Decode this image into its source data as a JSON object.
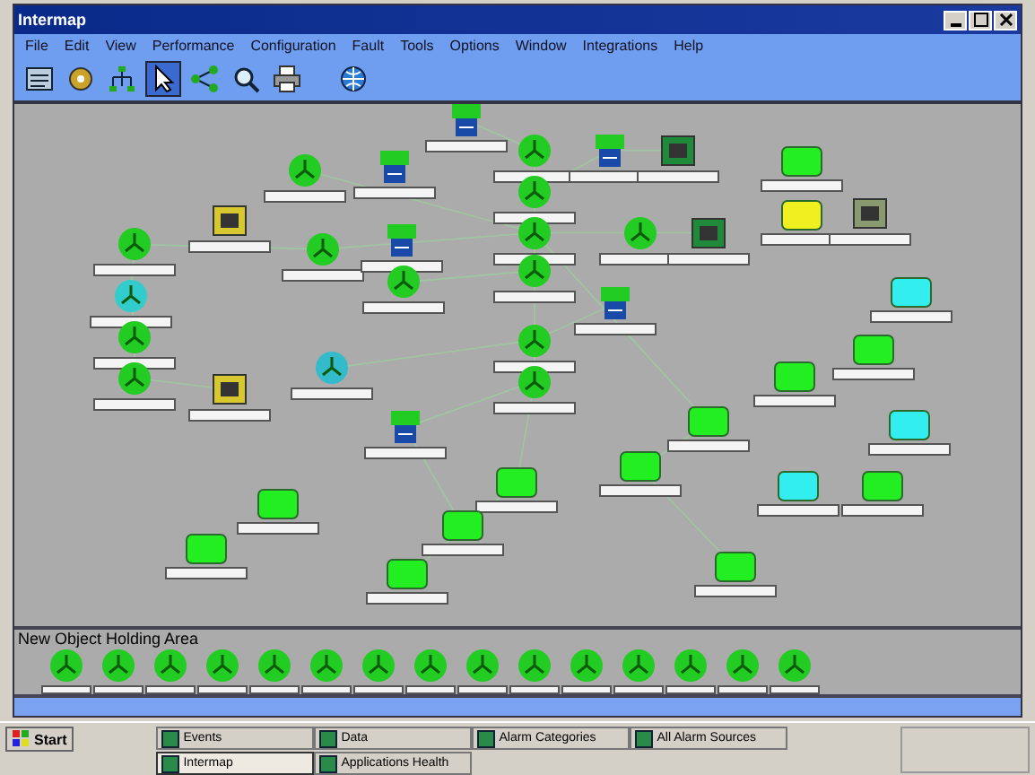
{
  "window": {
    "title": "Intermap"
  },
  "menu": [
    "File",
    "Edit",
    "View",
    "Performance",
    "Configuration",
    "Fault",
    "Tools",
    "Options",
    "Window",
    "Integrations",
    "Help"
  ],
  "toolbar": [
    {
      "kind": "list",
      "selected": false
    },
    {
      "kind": "gear",
      "selected": false
    },
    {
      "kind": "tree",
      "selected": false
    },
    {
      "kind": "pointer",
      "selected": true
    },
    {
      "kind": "link",
      "selected": false
    },
    {
      "kind": "zoom",
      "selected": false
    },
    {
      "kind": "print",
      "selected": false
    },
    {
      "kind": "globe",
      "selected": false
    }
  ],
  "nodes": [
    {
      "kind": "switch",
      "color": "#22cc22"
    },
    {
      "kind": "router",
      "color": "#22cc22"
    },
    {
      "kind": "switch",
      "color": "#22cc22"
    },
    {
      "kind": "device",
      "color": "#1f8a3a"
    },
    {
      "kind": "router",
      "color": "#22cc22"
    },
    {
      "kind": "switch",
      "color": "#22cc22"
    },
    {
      "kind": "box",
      "color": "#22ee22"
    },
    {
      "kind": "router",
      "color": "#22cc22"
    },
    {
      "kind": "box",
      "color": "#f0f020"
    },
    {
      "kind": "device",
      "color": "#8a9a70"
    },
    {
      "kind": "device",
      "color": "#d8c830"
    },
    {
      "kind": "router",
      "color": "#22cc22"
    },
    {
      "kind": "router",
      "color": "#22cc22"
    },
    {
      "kind": "switch",
      "color": "#22cc22"
    },
    {
      "kind": "router",
      "color": "#22cc22"
    },
    {
      "kind": "router",
      "color": "#22cc22"
    },
    {
      "kind": "device",
      "color": "#1f8a3a"
    },
    {
      "kind": "router",
      "color": "#22cc22"
    },
    {
      "kind": "router",
      "color": "#22cc22"
    },
    {
      "kind": "router",
      "color": "#33cccc"
    },
    {
      "kind": "router",
      "color": "#22cc22"
    },
    {
      "kind": "switch",
      "color": "#22cc22"
    },
    {
      "kind": "router",
      "color": "#22cc22"
    },
    {
      "kind": "box",
      "color": "#33eeee"
    },
    {
      "kind": "router",
      "color": "#22cc22"
    },
    {
      "kind": "router",
      "color": "#22cc22"
    },
    {
      "kind": "router",
      "color": "#33bbcc"
    },
    {
      "kind": "device",
      "color": "#d8c830"
    },
    {
      "kind": "box",
      "color": "#22ee22"
    },
    {
      "kind": "box",
      "color": "#22ee22"
    },
    {
      "kind": "switch",
      "color": "#22cc22"
    },
    {
      "kind": "box",
      "color": "#22ee22"
    },
    {
      "kind": "box",
      "color": "#33eeee"
    },
    {
      "kind": "box",
      "color": "#22ee22"
    },
    {
      "kind": "box",
      "color": "#22ee22"
    },
    {
      "kind": "box",
      "color": "#33eeee"
    },
    {
      "kind": "box",
      "color": "#22ee22"
    },
    {
      "kind": "box",
      "color": "#22ee22"
    },
    {
      "kind": "box",
      "color": "#22ee22"
    },
    {
      "kind": "box",
      "color": "#22ee22"
    },
    {
      "kind": "box",
      "color": "#22ee22"
    },
    {
      "kind": "box",
      "color": "#22ee22"
    }
  ],
  "holding_area": {
    "title": "New Object Holding Area",
    "count_icons": [
      {
        "kind": "router"
      },
      {
        "kind": "router"
      },
      {
        "kind": "router"
      },
      {
        "kind": "router"
      },
      {
        "kind": "router"
      },
      {
        "kind": "router"
      },
      {
        "kind": "router"
      },
      {
        "kind": "router"
      },
      {
        "kind": "router"
      },
      {
        "kind": "router"
      },
      {
        "kind": "router"
      },
      {
        "kind": "router"
      },
      {
        "kind": "router"
      },
      {
        "kind": "router"
      },
      {
        "kind": "router"
      }
    ]
  },
  "taskbar": {
    "start": "Start",
    "tasks": [
      {
        "label": "Events",
        "selected": false
      },
      {
        "label": "Data",
        "selected": false
      },
      {
        "label": "Alarm Categories",
        "selected": false
      },
      {
        "label": "All Alarm Sources",
        "selected": false
      },
      {
        "label": "Intermap",
        "selected": true
      },
      {
        "label": "Applications Health",
        "selected": false
      }
    ]
  }
}
